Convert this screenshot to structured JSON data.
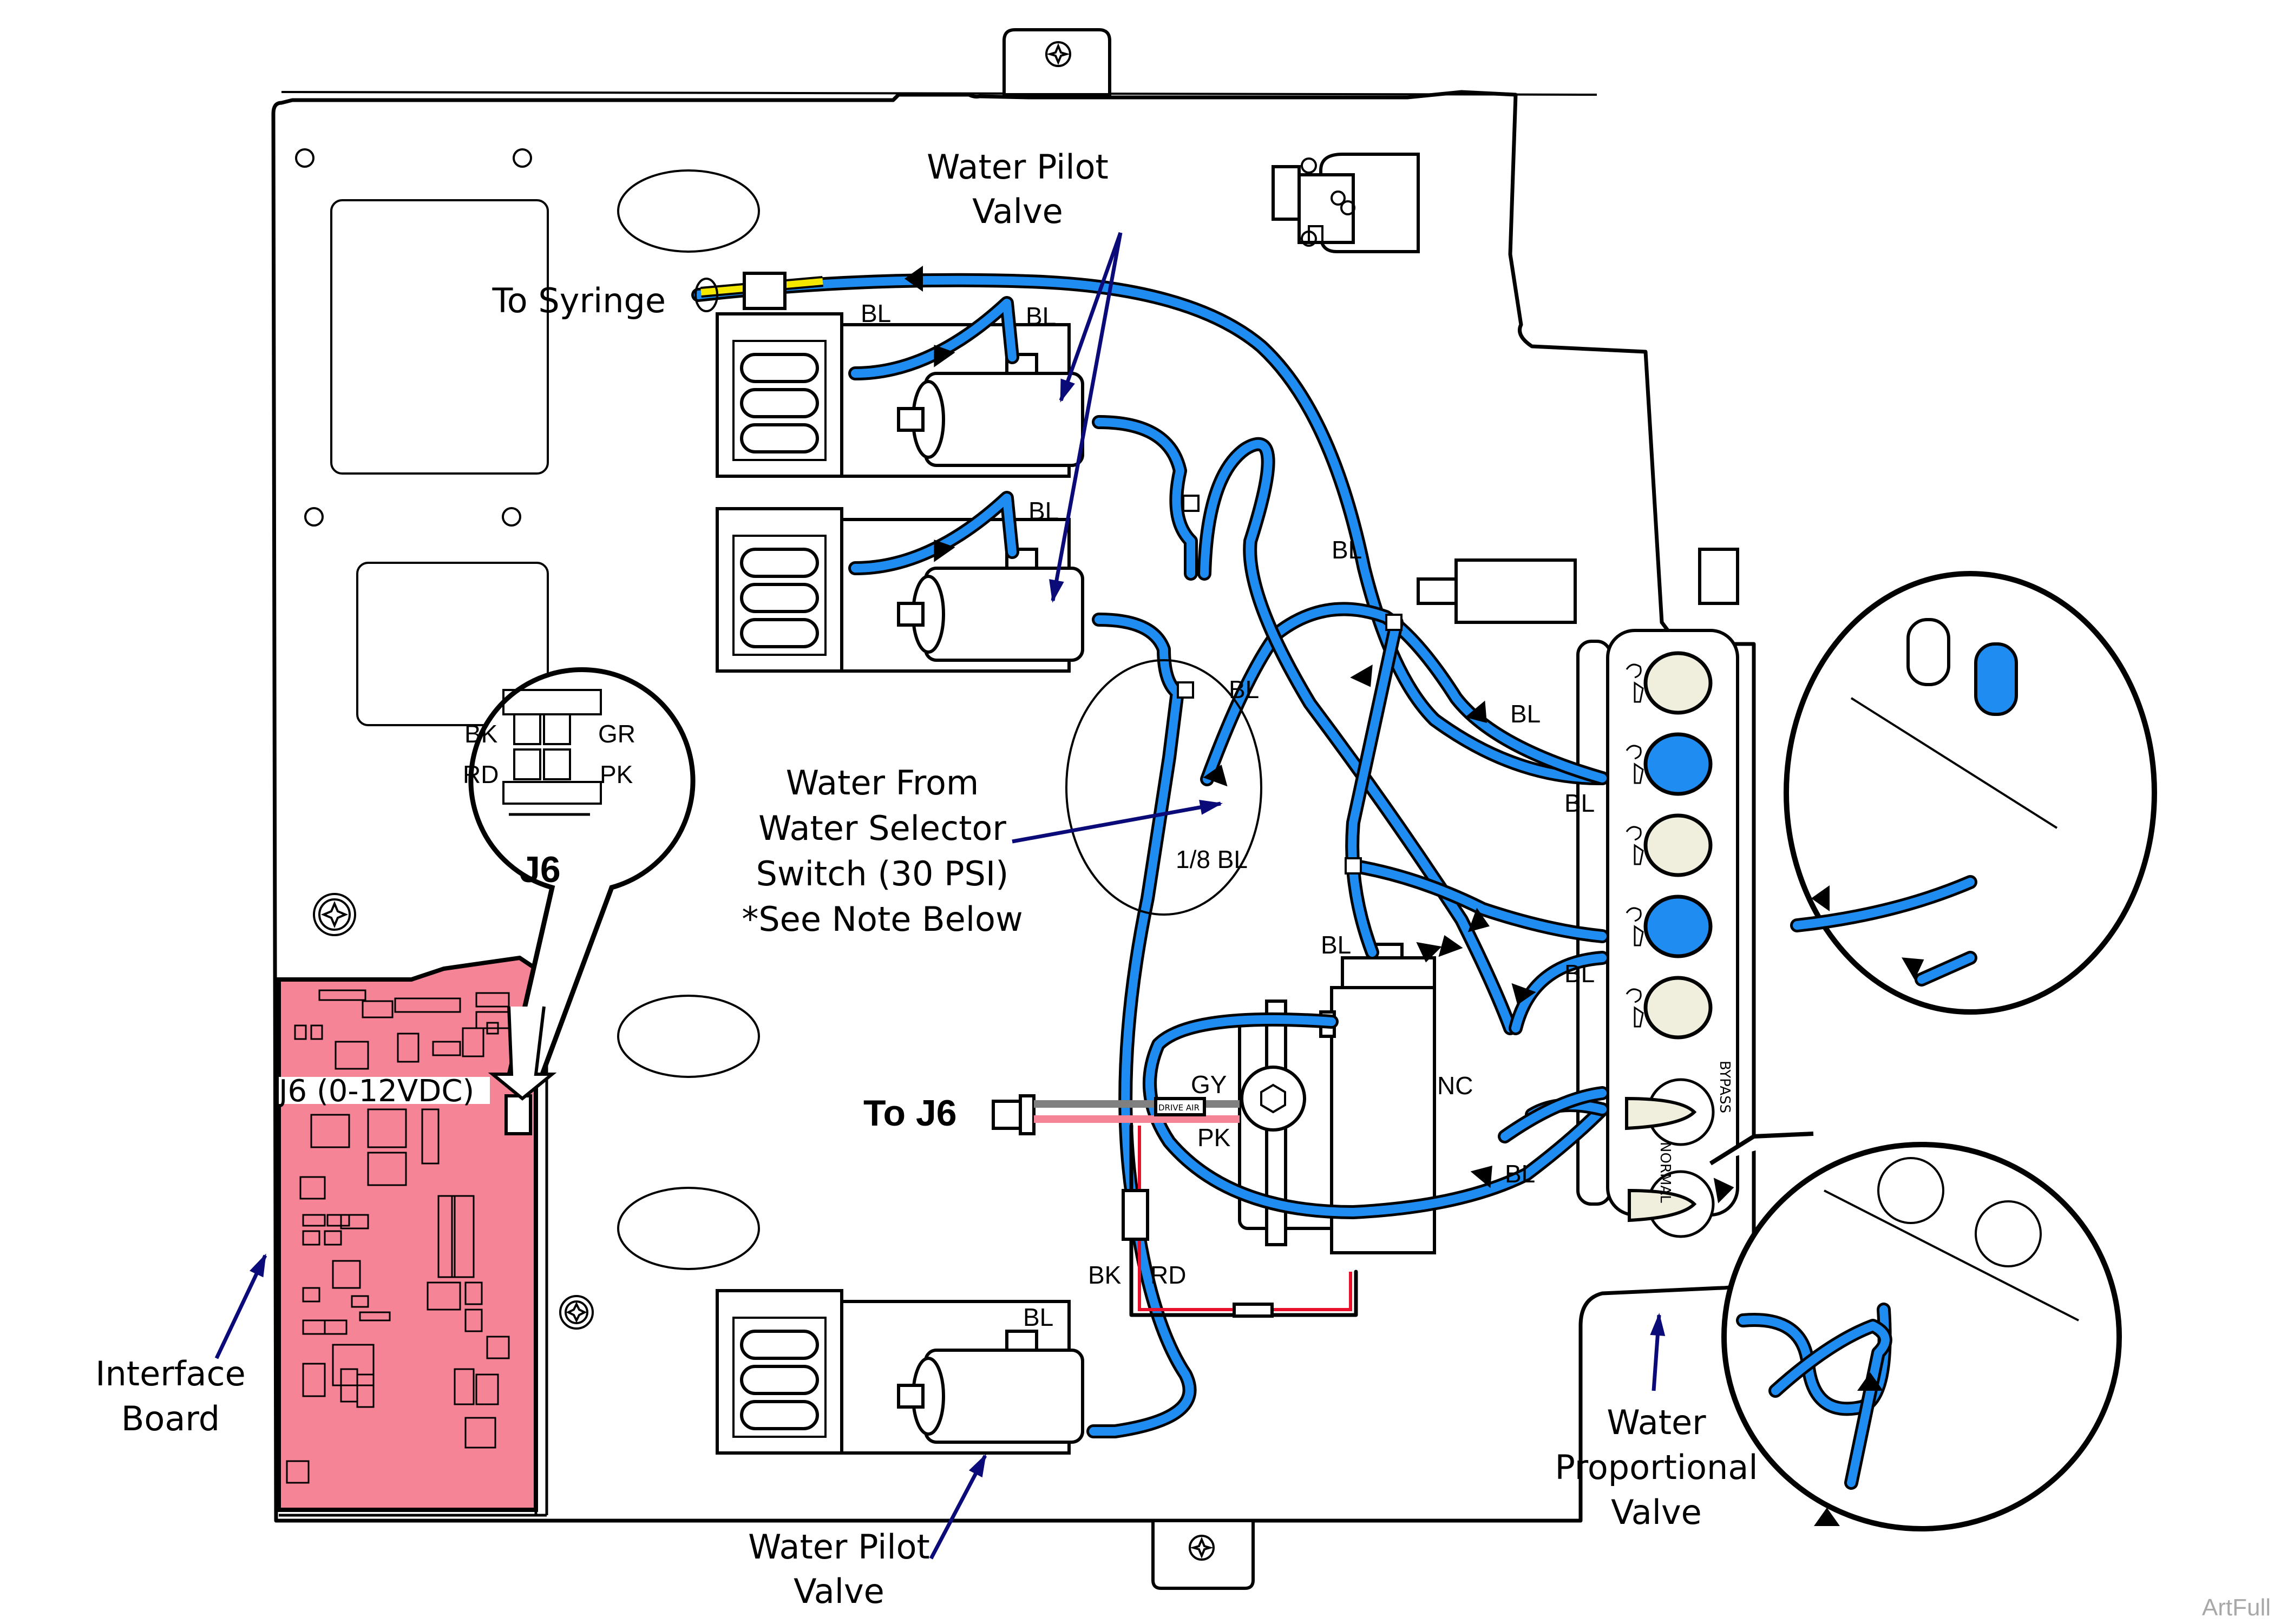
{
  "diagram": {
    "subject": "Water proportional valve plumbing and J6 wiring",
    "colors": {
      "tubing_blue": "#1e8cf0",
      "pcb_pink": "#f58596",
      "callout_navy": "#0a0a78",
      "button_cream": "#f0eedd",
      "wire_gray": "#808080",
      "wire_pink": "#f58596",
      "wire_red": "#e8102a",
      "wire_yellow": "#f5e800"
    },
    "labels": {
      "water_pilot_valve_top": [
        "Water Pilot",
        "Valve"
      ],
      "water_pilot_valve_bottom": [
        "Water Pilot",
        "Valve"
      ],
      "to_syringe": "To Syringe",
      "water_from": [
        "Water From",
        "Water Selector",
        "Switch (30 PSI)",
        "*See Note Below"
      ],
      "tube_size": "1/8 BL",
      "interface_board": [
        "Interface",
        "Board"
      ],
      "j6_voltage": "J6 (0-12VDC)",
      "to_j6": "To J6",
      "water_proportional_valve": [
        "Water",
        "Proportional",
        "Valve"
      ],
      "drive_air_tag": "DRIVE AIR",
      "nc": "NC",
      "bypass": "BYPASS",
      "normal": "NORMAL"
    },
    "j6_connector": {
      "title": "J6",
      "pins": {
        "top_left": "BK",
        "top_right": "GR",
        "bottom_left": "RD",
        "bottom_right": "PK"
      }
    },
    "wire_colors": {
      "solenoid_gray": "GY",
      "solenoid_pink": "PK",
      "power_black": "BK",
      "power_red": "RD"
    },
    "tube_tags": [
      "BL",
      "BL",
      "BL",
      "BL",
      "BL",
      "BL",
      "BL",
      "BL",
      "BL",
      "BL",
      "BL"
    ],
    "control_block_buttons": [
      {
        "icon": "syringe-air-icon",
        "state": "cream"
      },
      {
        "icon": "syringe-water-icon",
        "state": "blue"
      },
      {
        "icon": "handpiece-air-icon",
        "state": "cream"
      },
      {
        "icon": "handpiece-water-icon",
        "state": "blue"
      },
      {
        "icon": "flush-icon",
        "state": "cream"
      }
    ],
    "watermark": "ArtFull"
  }
}
